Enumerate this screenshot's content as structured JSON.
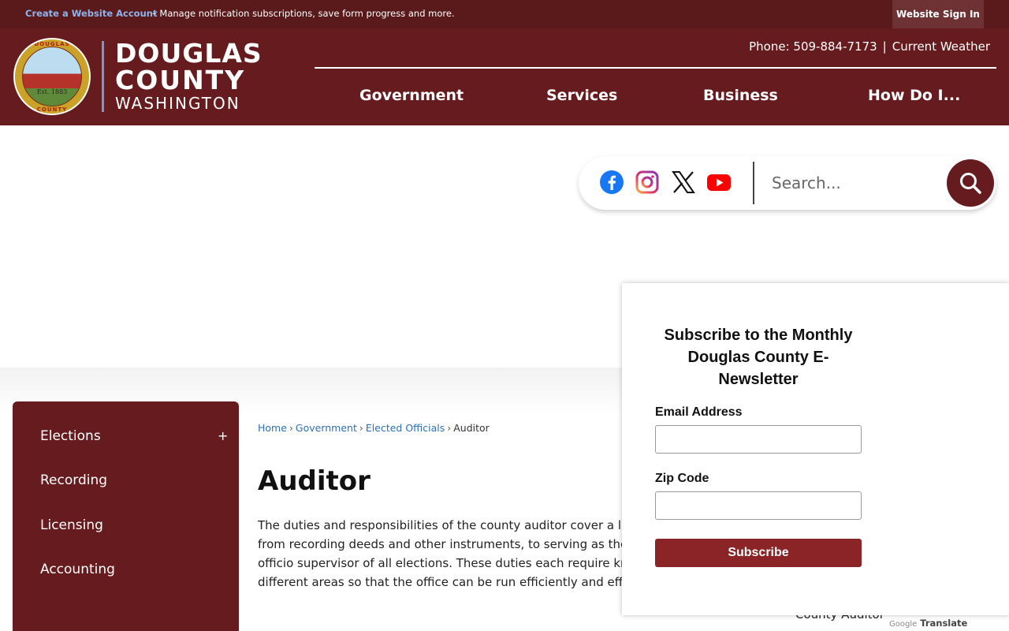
{
  "topbar": {
    "create_account_link": "Create a Website Account",
    "create_account_desc": "– Manage notification subscriptions, save form progress and more.",
    "signin_label": "Website Sign In",
    "background_color": "#5a1a1c"
  },
  "header": {
    "logo_line1": "DOUGLAS",
    "logo_line2": "COUNTY",
    "logo_line3": "WASHINGTON",
    "seal_top_text": "DOUGLAS",
    "seal_bottom_text": "COUNTY",
    "seal_est_text": "Est. 1883",
    "phone": "Phone: 509-884-7173",
    "phone_separator": "|",
    "weather_link": "Current Weather",
    "background_color": "#661c1f"
  },
  "nav": {
    "items": [
      "Government",
      "Services",
      "Business",
      "How Do I..."
    ]
  },
  "social": {
    "icons": [
      "facebook-icon",
      "instagram-icon",
      "x-icon",
      "youtube-icon"
    ]
  },
  "search": {
    "placeholder": "Search...",
    "value": ""
  },
  "sidebar": {
    "items": [
      "Elections",
      "Recording",
      "Licensing",
      "Accounting"
    ],
    "expand_symbol": "+"
  },
  "breadcrumb": {
    "items": [
      "Home",
      "Government",
      "Elected Officials",
      "Auditor"
    ],
    "separator": "›"
  },
  "page": {
    "title": "Auditor",
    "body_lines": [
      "The duties and responsibilities of the county auditor cover a la",
      "from recording deeds and other instruments, to serving as the",
      "officio supervisor of all elections. These duties each require kn",
      "different areas so that the office can be run efficiently and effe"
    ],
    "aside_label": "County Auditor"
  },
  "translate": {
    "brand": "Google",
    "label": "Translate"
  },
  "newsletter": {
    "title": "Subscribe to the Monthly Douglas County E-Newsletter",
    "email_label": "Email Address",
    "email_value": "",
    "zip_label": "Zip Code",
    "zip_value": "",
    "button_label": "Subscribe",
    "button_color": "#8a2427"
  }
}
